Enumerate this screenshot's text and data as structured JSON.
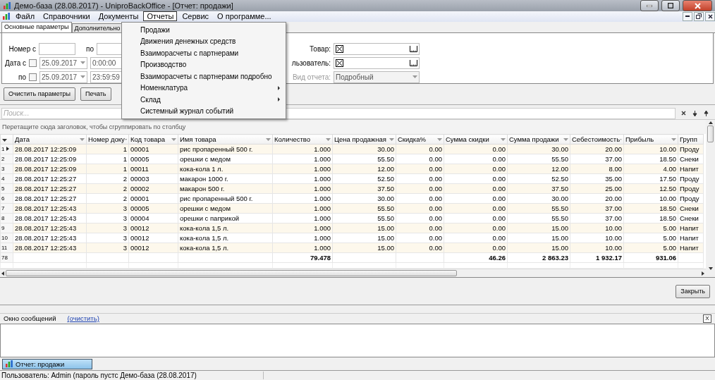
{
  "window": {
    "title": "Демо-база (28.08.2017) - UniproBackOffice  - [Отчет: продажи]"
  },
  "menu": [
    {
      "label": "Файл",
      "selected": false
    },
    {
      "label": "Справочники",
      "selected": false
    },
    {
      "label": "Документы",
      "selected": false
    },
    {
      "label": "Отчеты",
      "selected": true
    },
    {
      "label": "Сервис",
      "selected": false
    },
    {
      "label": "О программе...",
      "selected": false
    }
  ],
  "dropdown": [
    {
      "label": "Продажи",
      "kind": "item"
    },
    {
      "label": "Движения денежных средств",
      "kind": "item"
    },
    {
      "label": "Взаиморасчеты с партнерами",
      "kind": "item"
    },
    {
      "label": "Производство",
      "kind": "item"
    },
    {
      "label": "Взаиморасчеты с партнерами подробно",
      "kind": "item"
    },
    {
      "label": "Номенклатура",
      "kind": "submenu"
    },
    {
      "label": "Склад",
      "kind": "submenu"
    },
    {
      "label": "Системный журнал событий",
      "kind": "item"
    }
  ],
  "tabs": [
    {
      "label": "Основные параметры",
      "selected": true
    },
    {
      "label": "Дополнительно",
      "selected": false
    }
  ],
  "params": {
    "number_from_label": "Номер с",
    "number_to_label": "по",
    "date_from_label": "Дата с",
    "date_to_label": "по",
    "date_from": {
      "checked": false,
      "date": "25.09.2017",
      "time": "0:00:00"
    },
    "date_to": {
      "checked": false,
      "date": "25.09.2017",
      "time": "23:59:59"
    },
    "product_label": "Товар:",
    "user_label": "льзователь:",
    "report_type": {
      "label": "Вид отчета:",
      "value": "Подробный",
      "disabled": true
    }
  },
  "buttons": [
    "Очистить параметры",
    "Печать"
  ],
  "search": {
    "placeholder": "Поиск..."
  },
  "group_hint": "Перетащите сюда заголовок, чтобы сгруппировать по столбцу",
  "table": {
    "columns": [
      "Дата",
      "Номер доку",
      "Код товара",
      "Имя товара",
      "Количество",
      "Цена продажная",
      "Скидка%",
      "Сумма скидки",
      "Сумма продажи",
      "Себестоимость",
      "Прибыль",
      "Групп"
    ],
    "rows": [
      {
        "num": "1",
        "selected": true,
        "cells": [
          "28.08.2017 12:25:09",
          "1",
          "00001",
          "рис пропаренный 500 г.",
          "1.000",
          "30.00",
          "0.00",
          "0.00",
          "30.00",
          "20.00",
          "10.00",
          "Проду"
        ]
      },
      {
        "num": "2",
        "selected": false,
        "cells": [
          "28.08.2017 12:25:09",
          "1",
          "00005",
          "орешки с медом",
          "1.000",
          "55.50",
          "0.00",
          "0.00",
          "55.50",
          "37.00",
          "18.50",
          "Снеки"
        ]
      },
      {
        "num": "3",
        "selected": false,
        "cells": [
          "28.08.2017 12:25:09",
          "1",
          "00011",
          "кока-кола 1 л.",
          "1.000",
          "12.00",
          "0.00",
          "0.00",
          "12.00",
          "8.00",
          "4.00",
          "Напит"
        ]
      },
      {
        "num": "4",
        "selected": false,
        "cells": [
          "28.08.2017 12:25:27",
          "2",
          "00003",
          "макарон 1000 г.",
          "1.000",
          "52.50",
          "0.00",
          "0.00",
          "52.50",
          "35.00",
          "17.50",
          "Проду"
        ]
      },
      {
        "num": "5",
        "selected": false,
        "cells": [
          "28.08.2017 12:25:27",
          "2",
          "00002",
          "макарон 500 г.",
          "1.000",
          "37.50",
          "0.00",
          "0.00",
          "37.50",
          "25.00",
          "12.50",
          "Проду"
        ]
      },
      {
        "num": "6",
        "selected": false,
        "cells": [
          "28.08.2017 12:25:27",
          "2",
          "00001",
          "рис пропаренный 500 г.",
          "1.000",
          "30.00",
          "0.00",
          "0.00",
          "30.00",
          "20.00",
          "10.00",
          "Проду"
        ]
      },
      {
        "num": "7",
        "selected": false,
        "cells": [
          "28.08.2017 12:25:43",
          "3",
          "00005",
          "орешки с медом",
          "1.000",
          "55.50",
          "0.00",
          "0.00",
          "55.50",
          "37.00",
          "18.50",
          "Снеки"
        ]
      },
      {
        "num": "8",
        "selected": false,
        "cells": [
          "28.08.2017 12:25:43",
          "3",
          "00004",
          "орешки с паприкой",
          "1.000",
          "55.50",
          "0.00",
          "0.00",
          "55.50",
          "37.00",
          "18.50",
          "Снеки"
        ]
      },
      {
        "num": "9",
        "selected": false,
        "cells": [
          "28.08.2017 12:25:43",
          "3",
          "00012",
          "кока-кола 1,5 л.",
          "1.000",
          "15.00",
          "0.00",
          "0.00",
          "15.00",
          "10.00",
          "5.00",
          "Напит"
        ]
      },
      {
        "num": "10",
        "selected": false,
        "cells": [
          "28.08.2017 12:25:43",
          "3",
          "00012",
          "кока-кола 1,5 л.",
          "1.000",
          "15.00",
          "0.00",
          "0.00",
          "15.00",
          "10.00",
          "5.00",
          "Напит"
        ]
      },
      {
        "num": "11",
        "selected": false,
        "cells": [
          "28.08.2017 12:25:43",
          "3",
          "00012",
          "кока-кола 1,5 л.",
          "1.000",
          "15.00",
          "0.00",
          "0.00",
          "15.00",
          "10.00",
          "5.00",
          "Напит"
        ]
      }
    ],
    "footer": {
      "num": "78",
      "cells": [
        "",
        "",
        "",
        "",
        "79.478",
        "",
        "",
        "46.26",
        "2 863.23",
        "1 932.17",
        "931.06",
        ""
      ]
    }
  },
  "close_button": "Закрыть",
  "messages": {
    "title": "Окно сообщений",
    "clear_link": "(очистить)",
    "close": "X"
  },
  "taskbar": [
    {
      "label": "Отчет: продажи",
      "selected": true
    }
  ],
  "status_bar": "Пользователь: Admin (пароль пустс Демо-база (28.08.2017)"
}
